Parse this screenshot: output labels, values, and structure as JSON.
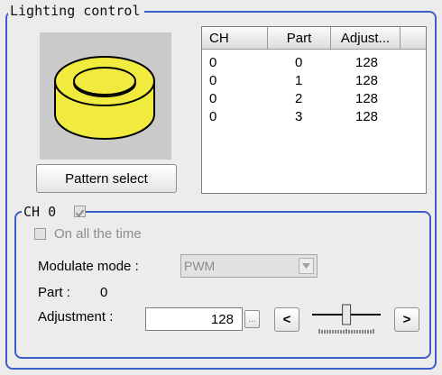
{
  "lighting_group": {
    "title": "Lighting control",
    "pattern_select_label": "Pattern select"
  },
  "table": {
    "headers": [
      "CH",
      "Part",
      "Adjust..."
    ],
    "rows": [
      [
        "0",
        "0",
        "128"
      ],
      [
        "0",
        "1",
        "128"
      ],
      [
        "0",
        "2",
        "128"
      ],
      [
        "0",
        "3",
        "128"
      ]
    ]
  },
  "channel_group": {
    "title": "CH 0",
    "enabled_checked": true,
    "on_all_time_label": "On all the time",
    "on_all_time_checked": false,
    "modulate_label": "Modulate mode :",
    "modulate_value": "PWM",
    "part_label": "Part :",
    "part_value": "0",
    "adjustment_label": "Adjustment :",
    "adjustment_value": "128",
    "ellipsis_label": "...",
    "decrement_label": "<",
    "increment_label": ">",
    "slider_level": 128,
    "slider_max": 255
  },
  "colors": {
    "group_border": "#3d5ec9",
    "ring_fill": "#f1ea3f",
    "image_bg": "#cacaca"
  }
}
